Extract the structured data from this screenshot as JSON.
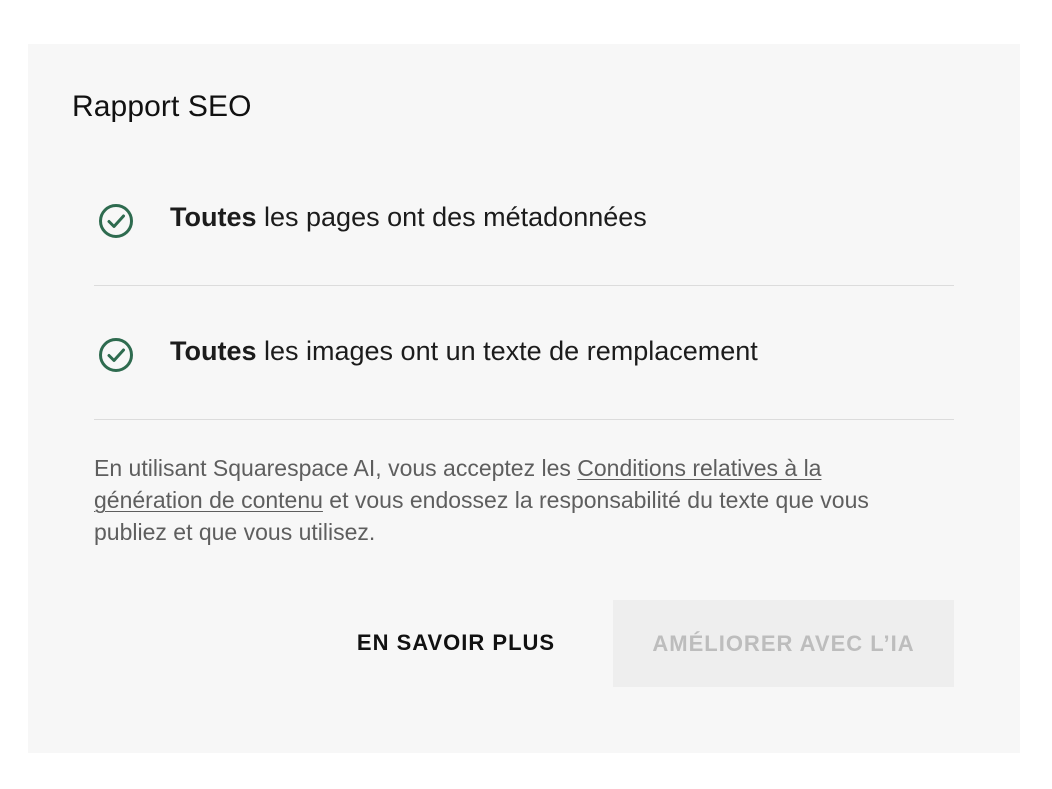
{
  "panel": {
    "title": "Rapport SEO"
  },
  "checks": [
    {
      "icon": "check-circle-icon",
      "bold": "Toutes",
      "rest": " les pages ont des métadonnées"
    },
    {
      "icon": "check-circle-icon",
      "bold": "Toutes",
      "rest": " les images ont un texte de remplacement"
    }
  ],
  "disclaimer": {
    "before": "En utilisant Squarespace AI, vous acceptez les ",
    "link": "Conditions relatives à la génération de contenu",
    "after": " et vous endossez la responsabilité du texte que vous publiez et que vous utilisez."
  },
  "actions": {
    "learn_more": "EN SAVOIR PLUS",
    "improve_ai": "AMÉLIORER AVEC L’IA"
  },
  "colors": {
    "check_green": "#2e6b4f",
    "panel_bg": "#f7f7f7",
    "disabled_button_bg": "#eeeeee"
  }
}
